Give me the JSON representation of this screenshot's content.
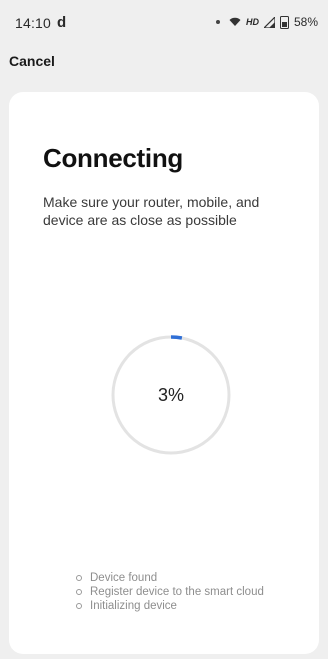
{
  "status_bar": {
    "time": "14:10",
    "app_indicator": "d",
    "battery": "58%",
    "network_label": "HD",
    "icons": [
      "dot-icon",
      "wifi-icon",
      "hd-icon",
      "signal-icon",
      "battery-icon"
    ]
  },
  "header": {
    "cancel_label": "Cancel"
  },
  "main": {
    "title": "Connecting",
    "subtitle": "Make sure your router, mobile, and device are as close as possible",
    "progress": {
      "percent_label": "3%",
      "value": 0.03
    },
    "steps": [
      {
        "label": "Device found"
      },
      {
        "label": "Register device to the smart cloud"
      },
      {
        "label": "Initializing device"
      }
    ]
  },
  "colors": {
    "background": "#efefef",
    "card": "#ffffff",
    "progress_track": "#e3e3e3",
    "progress_fill": "#2f6fd6"
  }
}
